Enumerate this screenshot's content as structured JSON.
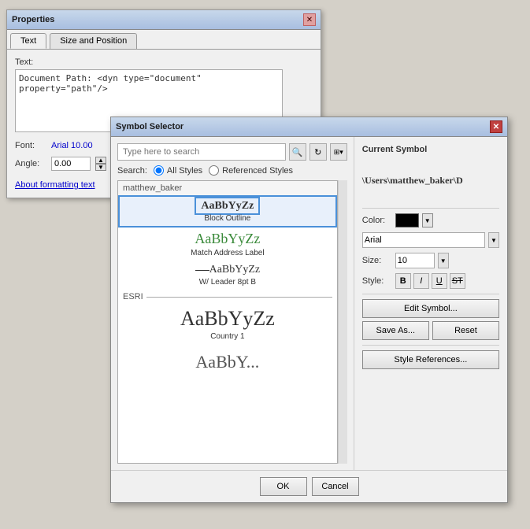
{
  "properties_window": {
    "title": "Properties",
    "tab_text": "Text",
    "tab_size": "Size and Position",
    "field_text_label": "Text:",
    "text_content": "Document Path: <dyn type=\"document\" property=\"path\"/>",
    "font_label": "Font:",
    "font_value": "Arial 10.00",
    "angle_label": "Angle:",
    "angle_value": "0.00",
    "link_text": "About formatting text",
    "close_label": "✕"
  },
  "symbol_selector": {
    "title": "Symbol Selector",
    "close_label": "✕",
    "search_placeholder": "Type here to search",
    "search_label": "Search:",
    "radio_all": "All Styles",
    "radio_ref": "Referenced Styles",
    "group_matthew": "matthew_baker",
    "item1_name": "Block Outline",
    "item2_name": "Match Address Label",
    "item3_name": "W/ Leader 8pt B",
    "group_esri": "ESRI",
    "item4_name": "Country 1",
    "current_symbol_title": "Current Symbol",
    "current_symbol_path": "\\Users\\matthew_baker\\D",
    "color_label": "Color:",
    "font_label": "Arial",
    "size_label": "Size:",
    "size_value": "10",
    "style_label": "Style:",
    "bold_label": "B",
    "italic_label": "I",
    "underline_label": "U",
    "strike_label": "ST",
    "edit_symbol_btn": "Edit Symbol...",
    "save_as_btn": "Save As...",
    "reset_btn": "Reset",
    "style_ref_btn": "Style References...",
    "ok_btn": "OK",
    "cancel_btn": "Cancel"
  }
}
